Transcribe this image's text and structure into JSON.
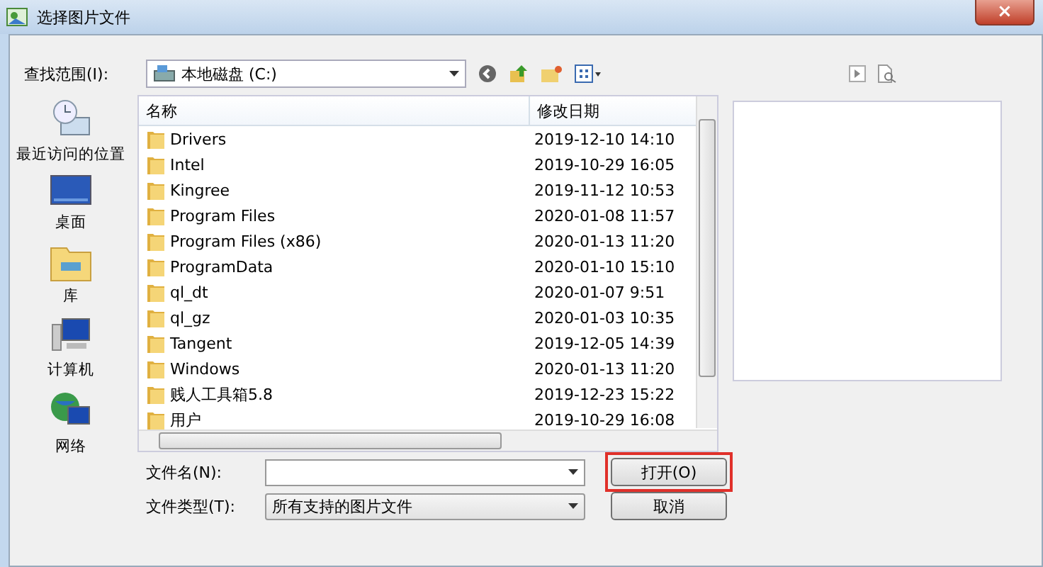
{
  "window": {
    "title": "选择图片文件",
    "close": "×"
  },
  "look_in": {
    "label": "查找范围(I):",
    "value": "本地磁盘 (C:)"
  },
  "sidebar": {
    "items": [
      {
        "label": "最近访问的位置",
        "kind": "recent"
      },
      {
        "label": "桌面",
        "kind": "desktop"
      },
      {
        "label": "库",
        "kind": "library"
      },
      {
        "label": "计算机",
        "kind": "computer"
      },
      {
        "label": "网络",
        "kind": "network"
      }
    ]
  },
  "table": {
    "columns": [
      "名称",
      "修改日期"
    ],
    "rows": [
      {
        "name": "Drivers",
        "date": "2019-12-10 14:10"
      },
      {
        "name": "Intel",
        "date": "2019-10-29 16:05"
      },
      {
        "name": "Kingree",
        "date": "2019-11-12 10:53"
      },
      {
        "name": "Program Files",
        "date": "2020-01-08 11:57"
      },
      {
        "name": "Program Files (x86)",
        "date": "2020-01-13 11:20"
      },
      {
        "name": "ProgramData",
        "date": "2020-01-10 15:10"
      },
      {
        "name": "ql_dt",
        "date": "2020-01-07 9:51"
      },
      {
        "name": "ql_gz",
        "date": "2020-01-03 10:35"
      },
      {
        "name": "Tangent",
        "date": "2019-12-05 14:39"
      },
      {
        "name": "Windows",
        "date": "2020-01-13 11:20"
      },
      {
        "name": "贱人工具箱5.8",
        "date": "2019-12-23 15:22"
      },
      {
        "name": "用户",
        "date": "2019-10-29 16:08"
      }
    ]
  },
  "file_name": {
    "label": "文件名(N):"
  },
  "file_type": {
    "label": "文件类型(T):",
    "value": "所有支持的图片文件"
  },
  "buttons": [
    {
      "label": "打开(O)",
      "highlighted": true
    },
    {
      "label": "取消",
      "highlighted": false
    }
  ]
}
